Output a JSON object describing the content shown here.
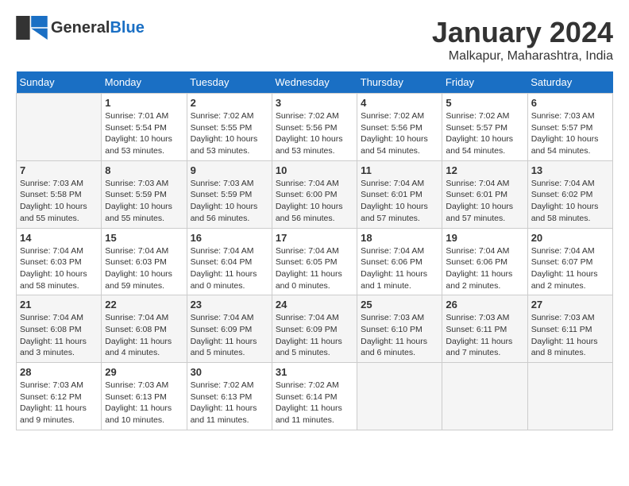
{
  "header": {
    "logo_text_general": "General",
    "logo_text_blue": "Blue",
    "month_year": "January 2024",
    "location": "Malkapur, Maharashtra, India"
  },
  "weekdays": [
    "Sunday",
    "Monday",
    "Tuesday",
    "Wednesday",
    "Thursday",
    "Friday",
    "Saturday"
  ],
  "weeks": [
    [
      {
        "day": "",
        "sunrise": "",
        "sunset": "",
        "daylight": ""
      },
      {
        "day": "1",
        "sunrise": "Sunrise: 7:01 AM",
        "sunset": "Sunset: 5:54 PM",
        "daylight": "Daylight: 10 hours and 53 minutes."
      },
      {
        "day": "2",
        "sunrise": "Sunrise: 7:02 AM",
        "sunset": "Sunset: 5:55 PM",
        "daylight": "Daylight: 10 hours and 53 minutes."
      },
      {
        "day": "3",
        "sunrise": "Sunrise: 7:02 AM",
        "sunset": "Sunset: 5:56 PM",
        "daylight": "Daylight: 10 hours and 53 minutes."
      },
      {
        "day": "4",
        "sunrise": "Sunrise: 7:02 AM",
        "sunset": "Sunset: 5:56 PM",
        "daylight": "Daylight: 10 hours and 54 minutes."
      },
      {
        "day": "5",
        "sunrise": "Sunrise: 7:02 AM",
        "sunset": "Sunset: 5:57 PM",
        "daylight": "Daylight: 10 hours and 54 minutes."
      },
      {
        "day": "6",
        "sunrise": "Sunrise: 7:03 AM",
        "sunset": "Sunset: 5:57 PM",
        "daylight": "Daylight: 10 hours and 54 minutes."
      }
    ],
    [
      {
        "day": "7",
        "sunrise": "Sunrise: 7:03 AM",
        "sunset": "Sunset: 5:58 PM",
        "daylight": "Daylight: 10 hours and 55 minutes."
      },
      {
        "day": "8",
        "sunrise": "Sunrise: 7:03 AM",
        "sunset": "Sunset: 5:59 PM",
        "daylight": "Daylight: 10 hours and 55 minutes."
      },
      {
        "day": "9",
        "sunrise": "Sunrise: 7:03 AM",
        "sunset": "Sunset: 5:59 PM",
        "daylight": "Daylight: 10 hours and 56 minutes."
      },
      {
        "day": "10",
        "sunrise": "Sunrise: 7:04 AM",
        "sunset": "Sunset: 6:00 PM",
        "daylight": "Daylight: 10 hours and 56 minutes."
      },
      {
        "day": "11",
        "sunrise": "Sunrise: 7:04 AM",
        "sunset": "Sunset: 6:01 PM",
        "daylight": "Daylight: 10 hours and 57 minutes."
      },
      {
        "day": "12",
        "sunrise": "Sunrise: 7:04 AM",
        "sunset": "Sunset: 6:01 PM",
        "daylight": "Daylight: 10 hours and 57 minutes."
      },
      {
        "day": "13",
        "sunrise": "Sunrise: 7:04 AM",
        "sunset": "Sunset: 6:02 PM",
        "daylight": "Daylight: 10 hours and 58 minutes."
      }
    ],
    [
      {
        "day": "14",
        "sunrise": "Sunrise: 7:04 AM",
        "sunset": "Sunset: 6:03 PM",
        "daylight": "Daylight: 10 hours and 58 minutes."
      },
      {
        "day": "15",
        "sunrise": "Sunrise: 7:04 AM",
        "sunset": "Sunset: 6:03 PM",
        "daylight": "Daylight: 10 hours and 59 minutes."
      },
      {
        "day": "16",
        "sunrise": "Sunrise: 7:04 AM",
        "sunset": "Sunset: 6:04 PM",
        "daylight": "Daylight: 11 hours and 0 minutes."
      },
      {
        "day": "17",
        "sunrise": "Sunrise: 7:04 AM",
        "sunset": "Sunset: 6:05 PM",
        "daylight": "Daylight: 11 hours and 0 minutes."
      },
      {
        "day": "18",
        "sunrise": "Sunrise: 7:04 AM",
        "sunset": "Sunset: 6:06 PM",
        "daylight": "Daylight: 11 hours and 1 minute."
      },
      {
        "day": "19",
        "sunrise": "Sunrise: 7:04 AM",
        "sunset": "Sunset: 6:06 PM",
        "daylight": "Daylight: 11 hours and 2 minutes."
      },
      {
        "day": "20",
        "sunrise": "Sunrise: 7:04 AM",
        "sunset": "Sunset: 6:07 PM",
        "daylight": "Daylight: 11 hours and 2 minutes."
      }
    ],
    [
      {
        "day": "21",
        "sunrise": "Sunrise: 7:04 AM",
        "sunset": "Sunset: 6:08 PM",
        "daylight": "Daylight: 11 hours and 3 minutes."
      },
      {
        "day": "22",
        "sunrise": "Sunrise: 7:04 AM",
        "sunset": "Sunset: 6:08 PM",
        "daylight": "Daylight: 11 hours and 4 minutes."
      },
      {
        "day": "23",
        "sunrise": "Sunrise: 7:04 AM",
        "sunset": "Sunset: 6:09 PM",
        "daylight": "Daylight: 11 hours and 5 minutes."
      },
      {
        "day": "24",
        "sunrise": "Sunrise: 7:04 AM",
        "sunset": "Sunset: 6:09 PM",
        "daylight": "Daylight: 11 hours and 5 minutes."
      },
      {
        "day": "25",
        "sunrise": "Sunrise: 7:03 AM",
        "sunset": "Sunset: 6:10 PM",
        "daylight": "Daylight: 11 hours and 6 minutes."
      },
      {
        "day": "26",
        "sunrise": "Sunrise: 7:03 AM",
        "sunset": "Sunset: 6:11 PM",
        "daylight": "Daylight: 11 hours and 7 minutes."
      },
      {
        "day": "27",
        "sunrise": "Sunrise: 7:03 AM",
        "sunset": "Sunset: 6:11 PM",
        "daylight": "Daylight: 11 hours and 8 minutes."
      }
    ],
    [
      {
        "day": "28",
        "sunrise": "Sunrise: 7:03 AM",
        "sunset": "Sunset: 6:12 PM",
        "daylight": "Daylight: 11 hours and 9 minutes."
      },
      {
        "day": "29",
        "sunrise": "Sunrise: 7:03 AM",
        "sunset": "Sunset: 6:13 PM",
        "daylight": "Daylight: 11 hours and 10 minutes."
      },
      {
        "day": "30",
        "sunrise": "Sunrise: 7:02 AM",
        "sunset": "Sunset: 6:13 PM",
        "daylight": "Daylight: 11 hours and 11 minutes."
      },
      {
        "day": "31",
        "sunrise": "Sunrise: 7:02 AM",
        "sunset": "Sunset: 6:14 PM",
        "daylight": "Daylight: 11 hours and 11 minutes."
      },
      {
        "day": "",
        "sunrise": "",
        "sunset": "",
        "daylight": ""
      },
      {
        "day": "",
        "sunrise": "",
        "sunset": "",
        "daylight": ""
      },
      {
        "day": "",
        "sunrise": "",
        "sunset": "",
        "daylight": ""
      }
    ]
  ]
}
